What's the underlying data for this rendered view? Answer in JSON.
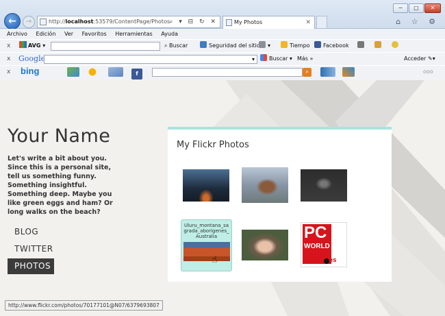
{
  "browser": {
    "url_prefix": "http://",
    "url_host": "localhost",
    "url_rest": ":53579/ContentPage/Photos",
    "address_tools": "⌕ ▾ ⊟ ↻ ✕",
    "tab_title": "My Photos",
    "tab_close": "✕",
    "window_buttons": {
      "minimize": "─",
      "maximize": "□",
      "close": "✕"
    },
    "chrome_icons": "⌂ ☆ ⚙"
  },
  "menu": [
    "Archivo",
    "Edición",
    "Ver",
    "Favoritos",
    "Herramientas",
    "Ayuda"
  ],
  "toolbar_avg": {
    "close": "x",
    "logo": "AVG",
    "dropdown": "▾",
    "search_label": "Buscar",
    "site_safety": "Seguridad del sitio",
    "weather": "Tiempo",
    "facebook": "Facebook"
  },
  "toolbar_google": {
    "close": "x",
    "logo": "Google",
    "dropdown": "▾",
    "search_label": "Buscar",
    "more": "Más »",
    "signin": "Acceder"
  },
  "toolbar_bing": {
    "close": "x",
    "logo": "bing",
    "facebook_glyph": "f",
    "go_glyph": "⌕",
    "more": "ooo"
  },
  "site": {
    "name": "Your Name",
    "bio": "Let's write a bit about you. Since this is a personal site, tell us something funny. Something insightful. Something deep. Maybe you like green eggs and ham? Or long walks on the beach?",
    "nav": [
      "BLOG",
      "TWITTER",
      "PHOTOS"
    ]
  },
  "flickr": {
    "title": "My Flickr Photos",
    "hover_caption": "Uluru_montana_sagrada_aborigenes_Australia",
    "pcworld": {
      "pc": "PC",
      "world": "WORLD",
      "es": "es"
    }
  },
  "status": {
    "url": "http://www.flickr.com/photos/70177101@N07/6379693807"
  },
  "colors": {
    "accent_teal": "#a9e4dc",
    "nav_active_bg": "#3b3b3b",
    "ie_blue": "#1d5fb5"
  }
}
